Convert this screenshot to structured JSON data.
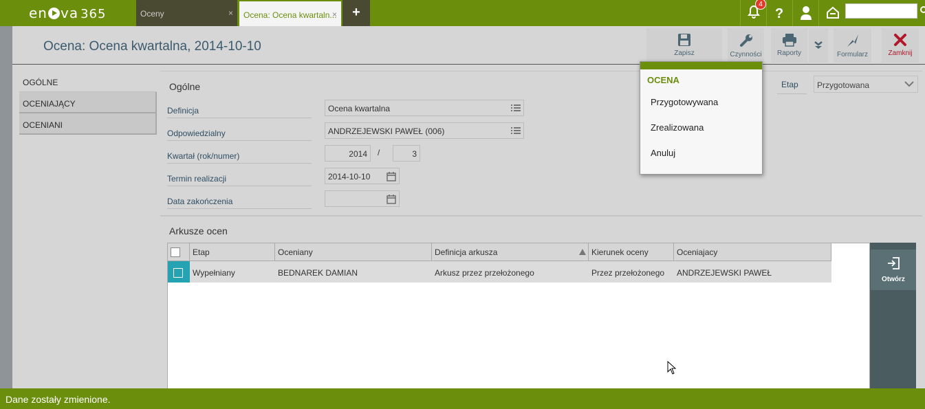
{
  "app": {
    "logo_text": "en",
    "logo_text2": "va",
    "logo_num": "365"
  },
  "tabs": [
    {
      "label": "Oceny",
      "close": "×"
    },
    {
      "label": "Ocena: Ocena kwartaln...",
      "close": "×"
    }
  ],
  "add_tab": "+",
  "notifications_count": "4",
  "page_title": "Ocena: Ocena kwartalna, 2014-10-10",
  "toolbar": {
    "save": "Zapisz",
    "actions": "Czynności",
    "reports": "Raporty",
    "form": "Formularz",
    "close": "Zamknij"
  },
  "nav": [
    "OGÓLNE",
    "OCENIAJĄCY",
    "OCENIANI"
  ],
  "general": {
    "title": "Ogólne",
    "fields": {
      "definition_label": "Definicja",
      "definition_value": "Ocena kwartalna",
      "responsible_label": "Odpowiedzialny",
      "responsible_value": "ANDRZEJEWSKI PAWEŁ (006)",
      "quarter_label": "Kwartał (rok/numer)",
      "quarter_year": "2014",
      "quarter_sep": "/",
      "quarter_num": "3",
      "deadline_label": "Termin realizacji",
      "deadline_value": "2014-10-10",
      "end_date_label": "Data zakończenia",
      "end_date_value": ""
    },
    "etap_label": "Etap",
    "etap_value": "Przygotowana"
  },
  "sheets": {
    "title": "Arkusze ocen",
    "columns": [
      "Etap",
      "Oceniany",
      "Definicja arkusza",
      "Kierunek oceny",
      "Oceniajacy"
    ],
    "rows": [
      [
        "Wypełniany",
        "BEDNAREK DAMIAN",
        "Arkusz przez przełożonego",
        "Przez przełożonego",
        "ANDRZEJEWSKI PAWEŁ"
      ]
    ],
    "open_button": "Otwórz"
  },
  "menu": {
    "title": "OCENA",
    "items": [
      "Przygotowywana",
      "Zrealizowana",
      "Anuluj"
    ]
  },
  "status": "Dane zostały zmienione.",
  "colors": {
    "brand": "#6b8e0d",
    "selection": "#26a3b2",
    "close_red": "#b0182a"
  }
}
